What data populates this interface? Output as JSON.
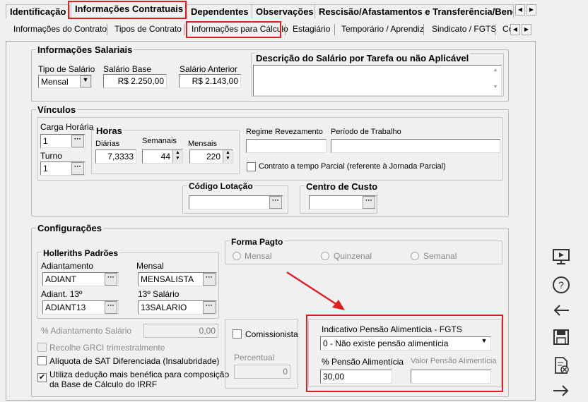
{
  "tabs_main": [
    "Identificação",
    "Informações Contratuais",
    "Dependentes",
    "Observações",
    "Rescisão/Afastamentos e Transferência/Bene"
  ],
  "tabs_sub": [
    "Informações do Contrato",
    "Tipos de Contrato",
    "Informações para Cálculo",
    "Estagiário",
    "Temporário / Aprendiz",
    "Sindicato / FGTS",
    "Co"
  ],
  "salariais": {
    "title": "Informações Salariais",
    "tipo_label": "Tipo de Salário",
    "tipo_value": "Mensal",
    "base_label": "Salário Base",
    "base_value": "R$ 2.250,00",
    "anterior_label": "Salário Anterior",
    "anterior_value": "R$ 2.143,00",
    "descricao_label": "Descrição do Salário por Tarefa ou não Aplicável"
  },
  "vinculos": {
    "title": "Vínculos",
    "carga_label": "Carga Horária",
    "carga_value": "1",
    "turno_label": "Turno",
    "turno_value": "1",
    "horas_title": "Horas",
    "diarias_label": "Diárias",
    "diarias_value": "7,3333",
    "semanais_label": "Semanais",
    "semanais_value": "44",
    "mensais_label": "Mensais",
    "mensais_value": "220",
    "regime_label": "Regime Revezamento",
    "periodo_label": "Período de Trabalho",
    "parcial_label": "Contrato a tempo Parcial (referente à Jornada Parcial)",
    "lotacao_title": "Código Lotação",
    "custo_title": "Centro de Custo"
  },
  "config": {
    "title": "Configurações",
    "holleriths_title": "Holleriths Padrões",
    "adiant_label": "Adiantamento",
    "adiant_value": "ADIANT",
    "mensal_label": "Mensal",
    "mensal_value": "MENSALISTA",
    "adiant13_label": "Adiant. 13º",
    "adiant13_value": "ADIANT13",
    "sal13_label": "13º Salário",
    "sal13_value": "13SALARIO",
    "forma_title": "Forma Pagto",
    "forma_options": [
      "Mensal",
      "Quinzenal",
      "Semanal"
    ],
    "perc_adiant_label": "% Adiantamento Salário",
    "perc_adiant_value": "0,00",
    "grci_label": "Recolhe GRCI trimestralmente",
    "sat_label": "Alíquota de SAT Diferenciada (Insalubridade)",
    "deducao_label1": "Utiliza dedução mais benéfica para composição",
    "deducao_label2": "da Base de Cálculo do IRRF",
    "comissionista_label": "Comissionista",
    "percentual_label": "Percentual",
    "percentual_value": "0",
    "pensao_title": "Indicativo Pensão Alimentícia - FGTS",
    "pensao_value": "0 - Não existe pensão alimentícia",
    "perc_pensao_label": "% Pensão Alimentícia",
    "perc_pensao_value": "30,00",
    "valor_pensao_label": "Valor Pensão Alimentícia"
  },
  "sidebar_icons": [
    "monitor-icon",
    "help-icon",
    "back-arrow-icon",
    "save-icon",
    "delete-document-icon",
    "forward-arrow-icon"
  ],
  "colors": {
    "highlight": "#e02020"
  }
}
